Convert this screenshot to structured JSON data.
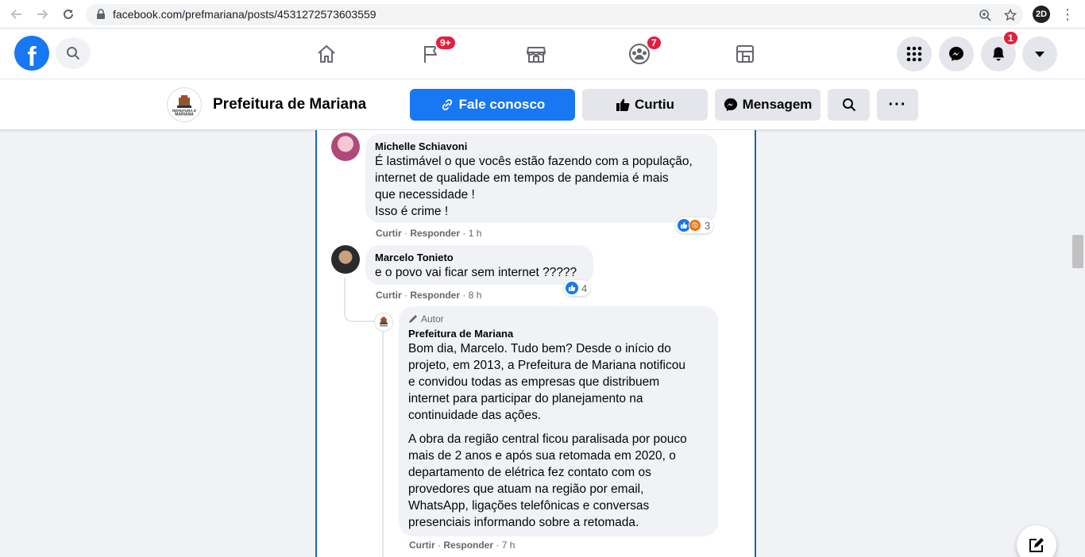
{
  "browser": {
    "url": "facebook.com/prefmariana/posts/4531272573603559",
    "profile_initials": "2D"
  },
  "fb_nav": {
    "logo_letter": "f",
    "notifications": {
      "pages_badge": "9+",
      "groups_badge": "7",
      "bell_badge": "1"
    }
  },
  "page_header": {
    "avatar_text": "PREFEITURA DE MARIANA",
    "page_name": "Prefeitura de Mariana",
    "contact_label": "Fale conosco",
    "liked_label": "Curtiu",
    "message_label": "Mensagem",
    "more_label": "···"
  },
  "comments": [
    {
      "author": "Michelle Schiavoni",
      "text": "É lastimável o que vocês estão fazendo com a população,\ninternet de qualidade em tempos de pandemia é mais\nque necessidade !\nIsso é crime !",
      "like": "Curtir",
      "reply": "Responder",
      "time": "1 h",
      "reaction_count": "3"
    },
    {
      "author": "Marcelo Tonieto",
      "text": "e o povo vai ficar sem internet ?????",
      "like": "Curtir",
      "reply": "Responder",
      "time": "8 h",
      "reaction_count": "4"
    }
  ],
  "reply": {
    "badge": "Autor",
    "author": "Prefeitura de Mariana",
    "paragraph1": "Bom dia, Marcelo. Tudo bem? Desde o início do\nprojeto, em 2013, a Prefeitura de Mariana notificou\ne convidou todas as empresas que distribuem\ninternet para participar do planejamento na\ncontinuidade das ações.",
    "paragraph2": "A obra da região central ficou paralisada por pouco\nmais de 2 anos e após sua retomada em 2020, o\ndepartamento de elétrica fez contato com os\nprovedores que atuam na região por email,\nWhatsApp, ligações telefônicas e conversas\npresenciais informando sobre a retomada.",
    "like": "Curtir",
    "reply": "Responder",
    "time": "7 h"
  },
  "colors": {
    "fb_blue": "#1877f2",
    "badge_red": "#e41e3f",
    "bubble_gray": "#f0f2f5",
    "frame_blue": "#1565c0"
  }
}
